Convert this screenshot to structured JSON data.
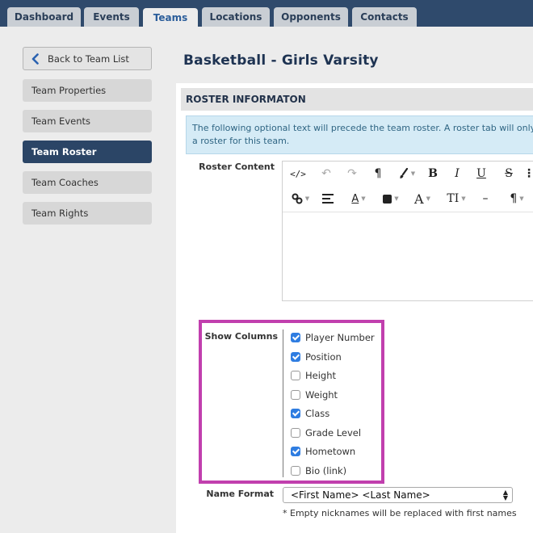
{
  "nav": {
    "tabs": [
      {
        "label": "Dashboard",
        "active": false
      },
      {
        "label": "Events",
        "active": false
      },
      {
        "label": "Teams",
        "active": true
      },
      {
        "label": "Locations",
        "active": false
      },
      {
        "label": "Opponents",
        "active": false
      },
      {
        "label": "Contacts",
        "active": false
      }
    ]
  },
  "sidebar": {
    "back_label": "Back to Team List",
    "items": [
      {
        "label": "Team Properties",
        "active": false
      },
      {
        "label": "Team Events",
        "active": false
      },
      {
        "label": "Team Roster",
        "active": true
      },
      {
        "label": "Team Coaches",
        "active": false
      },
      {
        "label": "Team Rights",
        "active": false
      }
    ]
  },
  "page": {
    "title": "Basketball - Girls Varsity"
  },
  "roster": {
    "section_title": "ROSTER INFORMATON",
    "info_line1": "The following optional text will precede the team roster. A roster tab will only b",
    "info_line2": "a roster for this team.",
    "content_label": "Roster Content",
    "editor_text": ""
  },
  "columns": {
    "label": "Show Columns",
    "options": [
      {
        "label": "Player Number",
        "checked": true
      },
      {
        "label": "Position",
        "checked": true
      },
      {
        "label": "Height",
        "checked": false
      },
      {
        "label": "Weight",
        "checked": false
      },
      {
        "label": "Class",
        "checked": true
      },
      {
        "label": "Grade Level",
        "checked": false
      },
      {
        "label": "Hometown",
        "checked": true
      },
      {
        "label": "Bio (link)",
        "checked": false
      }
    ]
  },
  "name_format": {
    "label": "Name Format",
    "selected": "<First Name> <Last Name>",
    "note": "* Empty nicknames will be replaced with first names"
  },
  "colors": {
    "nav_bg": "#2f4a6c",
    "active_sidebar": "#2b4566",
    "highlight_border": "#c13fae",
    "checkbox_on": "#2f7de1",
    "info_bg": "#d5ebf6"
  }
}
